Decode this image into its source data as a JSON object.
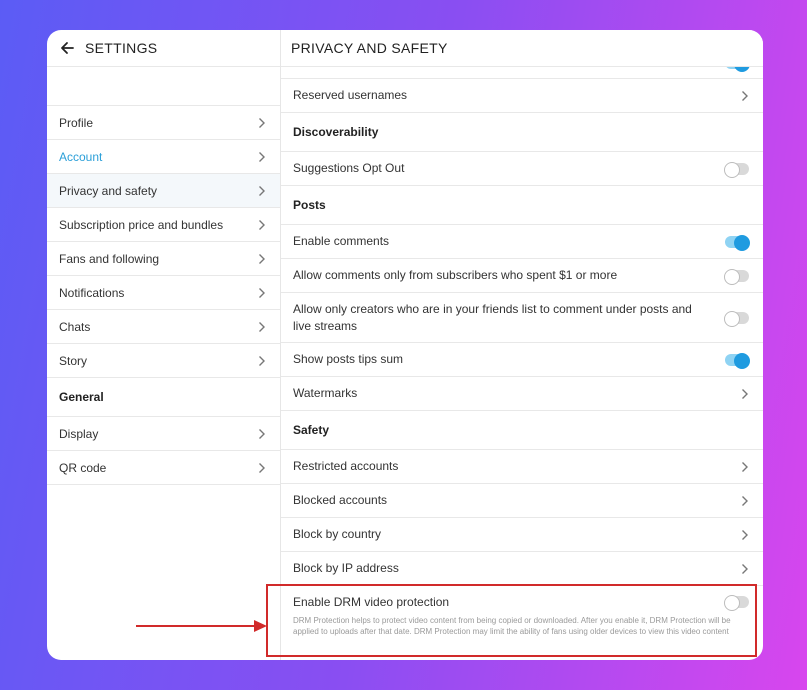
{
  "left": {
    "title": "SETTINGS",
    "items": [
      {
        "label": "Profile"
      },
      {
        "label": "Account"
      },
      {
        "label": "Privacy and safety"
      },
      {
        "label": "Subscription price and bundles"
      },
      {
        "label": "Fans and following"
      },
      {
        "label": "Notifications"
      },
      {
        "label": "Chats"
      },
      {
        "label": "Story"
      }
    ],
    "general_heading": "General",
    "general_items": [
      {
        "label": "Display"
      },
      {
        "label": "QR code"
      }
    ]
  },
  "right": {
    "title": "PRIVACY AND SAFETY",
    "reserved_usernames": "Reserved usernames",
    "discoverability_heading": "Discoverability",
    "suggestions_opt_out": "Suggestions Opt Out",
    "posts_heading": "Posts",
    "enable_comments": "Enable comments",
    "comments_subscribers": "Allow comments only from subscribers who spent $1 or more",
    "comments_friends": "Allow only creators who are in your friends list to comment under posts and live streams",
    "show_tips_sum": "Show posts tips sum",
    "watermarks": "Watermarks",
    "safety_heading": "Safety",
    "restricted_accounts": "Restricted accounts",
    "blocked_accounts": "Blocked accounts",
    "block_by_country": "Block by country",
    "block_by_ip": "Block by IP address",
    "drm_title": "Enable DRM video protection",
    "drm_description": "DRM Protection helps to protect video content from being copied or downloaded. After you enable it, DRM Protection will be applied to uploads after that date. DRM Protection may limit the ability of fans using older devices to view this video content"
  },
  "toggles": {
    "top_cut": true,
    "suggestions_opt_out": false,
    "enable_comments": true,
    "comments_subscribers": false,
    "comments_friends": false,
    "show_tips_sum": true,
    "drm": false
  },
  "colors": {
    "accent": "#2b9fd8",
    "highlight": "#d12a2a",
    "toggle_on": "#1f9be0"
  }
}
